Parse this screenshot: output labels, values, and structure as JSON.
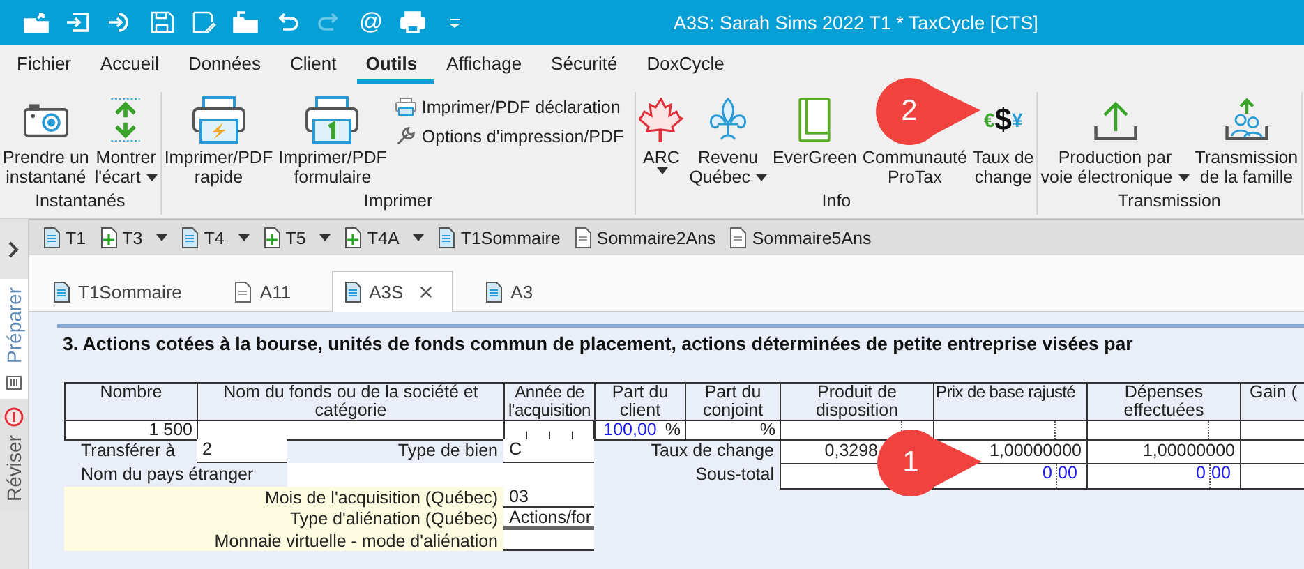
{
  "window": {
    "title": "A3S: Sarah Sims 2022 T1 * TaxCycle [CTS]"
  },
  "quick_access": [
    {
      "disabled": false
    },
    {
      "disabled": false
    },
    {
      "disabled": false
    },
    {
      "disabled": false
    },
    {
      "disabled": false
    },
    {
      "disabled": false
    },
    {
      "disabled": false
    },
    {
      "disabled": true
    },
    {
      "symbol": "@",
      "disabled": false
    },
    {
      "disabled": false
    },
    {
      "disabled": false
    }
  ],
  "ribbon": {
    "tabs": [
      {
        "label": "Fichier",
        "selected": false
      },
      {
        "label": "Accueil",
        "selected": false
      },
      {
        "label": "Données",
        "selected": false
      },
      {
        "label": "Client",
        "selected": false
      },
      {
        "label": "Outils",
        "selected": true
      },
      {
        "label": "Affichage",
        "selected": false
      },
      {
        "label": "Sécurité",
        "selected": false
      },
      {
        "label": "DoxCycle",
        "selected": false
      }
    ],
    "groups": [
      {
        "label": "Instantanés",
        "buttons": [
          {
            "kind": "large",
            "label": "Prendre un\ninstantané",
            "dropdown": false
          },
          {
            "kind": "large",
            "label": "Montrer\nl'écart",
            "dropdown": true
          }
        ]
      },
      {
        "label": "Imprimer",
        "buttons": [
          {
            "kind": "large",
            "label": "Imprimer/PDF\nrapide",
            "dropdown": false
          },
          {
            "kind": "large",
            "label": "Imprimer/PDF\nformulaire",
            "dropdown": false
          },
          {
            "kind": "small",
            "label": "Imprimer/PDF déclaration"
          },
          {
            "kind": "small",
            "label": "Options d'impression/PDF"
          }
        ]
      },
      {
        "label": "Info",
        "buttons": [
          {
            "kind": "large",
            "label": "ARC",
            "dropdown": true
          },
          {
            "kind": "large",
            "label": "Revenu\nQuébec",
            "dropdown": true
          },
          {
            "kind": "large",
            "label": "EverGreen",
            "dropdown": false
          },
          {
            "kind": "large",
            "label": "Communauté\nProTax",
            "dropdown": false
          },
          {
            "kind": "large",
            "label": "Taux de\nchange",
            "dropdown": false,
            "symbols": [
              "€",
              "$",
              "¥"
            ]
          }
        ]
      },
      {
        "label": "Transmission",
        "buttons": [
          {
            "kind": "large",
            "label": "Production par\nvoie électronique",
            "dropdown": true
          },
          {
            "kind": "large",
            "label": "Transmission\nde la famille",
            "dropdown": false
          }
        ]
      }
    ]
  },
  "side_panel": {
    "panels": [
      {
        "label": "Préparer",
        "selected": true
      },
      {
        "label": "Réviser",
        "selected": false
      }
    ]
  },
  "form_bar": [
    {
      "label": "T1",
      "kind": "form",
      "dropdown": false
    },
    {
      "label": "T3",
      "kind": "add",
      "dropdown": true
    },
    {
      "label": "T4",
      "kind": "form",
      "dropdown": true
    },
    {
      "label": "T5",
      "kind": "add",
      "dropdown": true
    },
    {
      "label": "T4A",
      "kind": "add",
      "dropdown": true
    },
    {
      "label": "T1Sommaire",
      "kind": "form",
      "dropdown": false
    },
    {
      "label": "Sommaire2Ans",
      "kind": "plain",
      "dropdown": false
    },
    {
      "label": "Sommaire5Ans",
      "kind": "plain",
      "dropdown": false
    }
  ],
  "doc_tabs": [
    {
      "label": "T1Sommaire",
      "kind": "form",
      "selected": false
    },
    {
      "label": "A11",
      "kind": "plain",
      "selected": false
    },
    {
      "label": "A3S",
      "kind": "form",
      "selected": true
    },
    {
      "label": "A3",
      "kind": "form",
      "selected": false
    }
  ],
  "form": {
    "title": "3. Actions cotées à la bourse, unités de fonds commun de placement, actions déterminées de petite entreprise visées par",
    "columns": [
      "Nombre",
      "Nom du fonds ou de la société et catégorie",
      "Année de l'acquisition",
      "Part du client",
      "Part du conjoint",
      "Produit de disposition",
      "Prix de base rajusté",
      "Dépenses effectuées",
      "Gain ("
    ],
    "row": {
      "nombre": "1 500",
      "part_client": "100,00",
      "part_client_unit": "%",
      "part_conjoint_unit": "%"
    },
    "transfer": {
      "label": "Transférer à",
      "value": "2"
    },
    "property_type": {
      "label": "Type de bien",
      "value": "C"
    },
    "country": {
      "label": "Nom du pays étranger"
    },
    "exchange_rate": {
      "label": "Taux de change",
      "values": [
        "0,3298",
        "1,00000000",
        "1,00000000"
      ]
    },
    "subtotal": {
      "label": "Sous-total",
      "values": [
        {
          "int": "0",
          "dec": "00"
        },
        {
          "int": "0",
          "dec": "00"
        }
      ]
    },
    "quebec": [
      {
        "label": "Mois de l'acquisition (Québec)",
        "value": "03"
      },
      {
        "label": "Type d'aliénation (Québec)",
        "value": "Actions/for"
      },
      {
        "label": "Monnaie virtuelle - mode d'aliénation"
      }
    ]
  },
  "callouts": [
    {
      "label": "2"
    },
    {
      "label": "1"
    }
  ]
}
